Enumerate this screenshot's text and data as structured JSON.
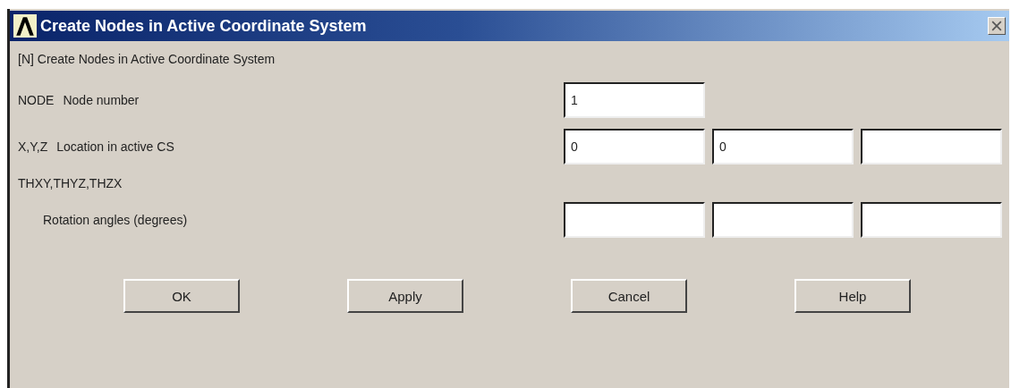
{
  "window": {
    "title": "Create Nodes in Active Coordinate System"
  },
  "header": "[N]  Create Nodes in Active Coordinate System",
  "rows": [
    {
      "kind": "fields",
      "code": "NODE",
      "label": "Node number",
      "fields": [
        {
          "value": "1",
          "disabled": false
        }
      ]
    },
    {
      "kind": "fields",
      "code": "X,Y,Z",
      "label": "Location in active CS",
      "fields": [
        {
          "value": "0",
          "disabled": false
        },
        {
          "value": "0",
          "disabled": false
        },
        {
          "disabled": false
        }
      ]
    },
    {
      "kind": "caption",
      "code": "THXY,THYZ,THZX"
    },
    {
      "kind": "fields",
      "label": "Rotation angles (degrees)",
      "fields": [
        {
          "disabled": false
        },
        {
          "disabled": false
        },
        {
          "disabled": false
        }
      ]
    }
  ],
  "buttons": [
    "OK",
    "Apply",
    "Cancel",
    "Help"
  ]
}
